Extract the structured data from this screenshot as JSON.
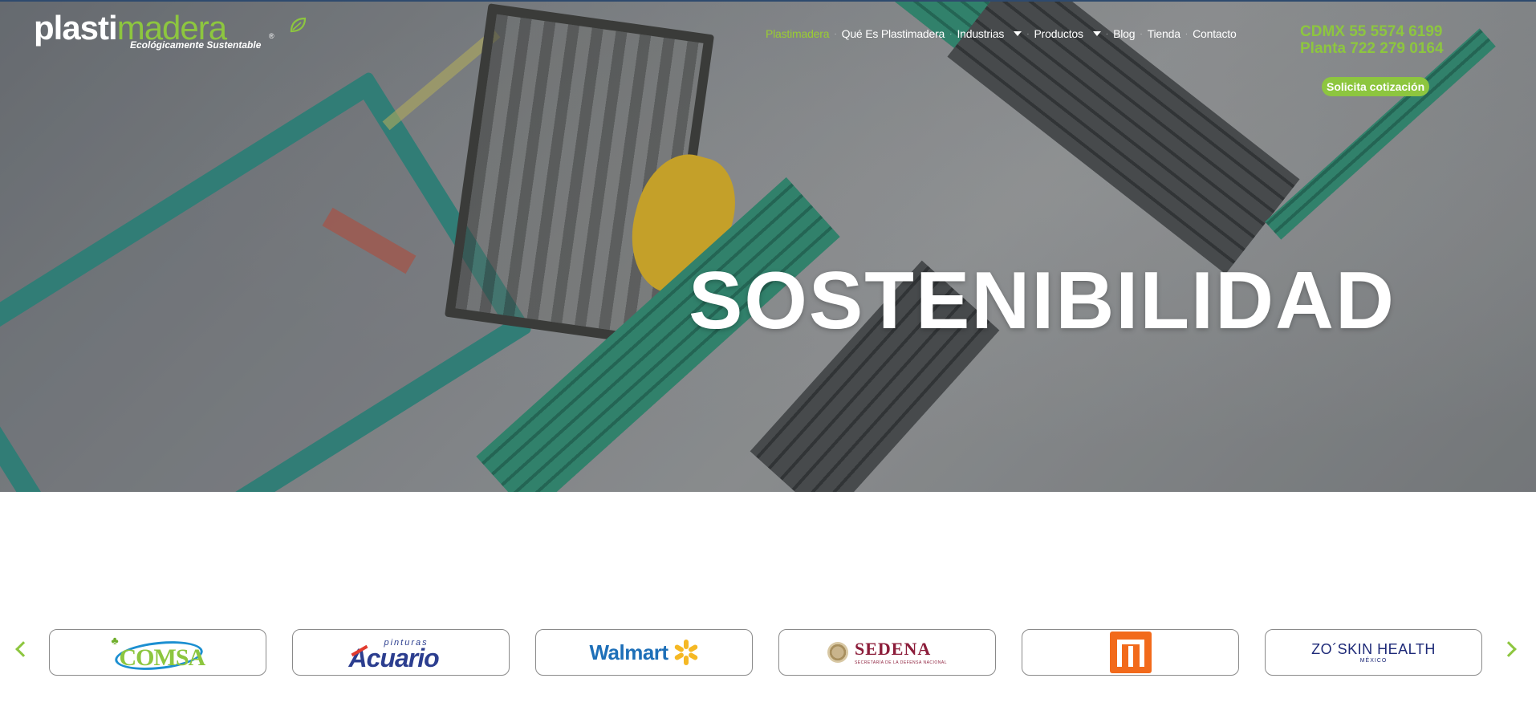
{
  "brand": {
    "name_part1": "plasti",
    "name_part2": "madera",
    "registered": "®",
    "tagline": "Ecológicamente Sustentable"
  },
  "nav": {
    "items": [
      {
        "label": "Plastimadera",
        "active": true,
        "dropdown": false
      },
      {
        "label": "Qué Es Plastimadera",
        "active": false,
        "dropdown": false
      },
      {
        "label": "Industrias",
        "active": false,
        "dropdown": true
      },
      {
        "label": "Productos",
        "active": false,
        "dropdown": true
      },
      {
        "label": "Blog",
        "active": false,
        "dropdown": false
      },
      {
        "label": "Tienda",
        "active": false,
        "dropdown": false
      },
      {
        "label": "Contacto",
        "active": false,
        "dropdown": false
      }
    ],
    "separator": "·"
  },
  "contact": {
    "phone_cdmx": "CDMX 55 5574 6199",
    "phone_planta": "Planta 722 279 0164",
    "cta_label": "Solicita cotización"
  },
  "hero": {
    "headline": "SOSTENIBILIDAD"
  },
  "clients": {
    "logos": [
      {
        "id": "comsa",
        "text": "COMSA"
      },
      {
        "id": "acuario",
        "small": "pinturas",
        "big": "Acuario"
      },
      {
        "id": "walmart",
        "text": "Walmart"
      },
      {
        "id": "sedena",
        "big": "SEDENA",
        "small": "SECRETARÍA DE LA DEFENSA NACIONAL"
      },
      {
        "id": "metro",
        "text": ""
      },
      {
        "id": "zo",
        "big": "ZO´SKIN HEALTH",
        "small": "MÉXICO"
      }
    ]
  },
  "colors": {
    "brand_green": "#8dc63f",
    "nav_active": "#9acd32",
    "top_border": "#2e4a6e",
    "card_border": "#8a8a8a"
  },
  "icons": {
    "carousel_prev": "chevron-left-icon",
    "carousel_next": "chevron-right-icon",
    "dropdown": "caret-down-icon",
    "leaf": "leaf-icon"
  }
}
